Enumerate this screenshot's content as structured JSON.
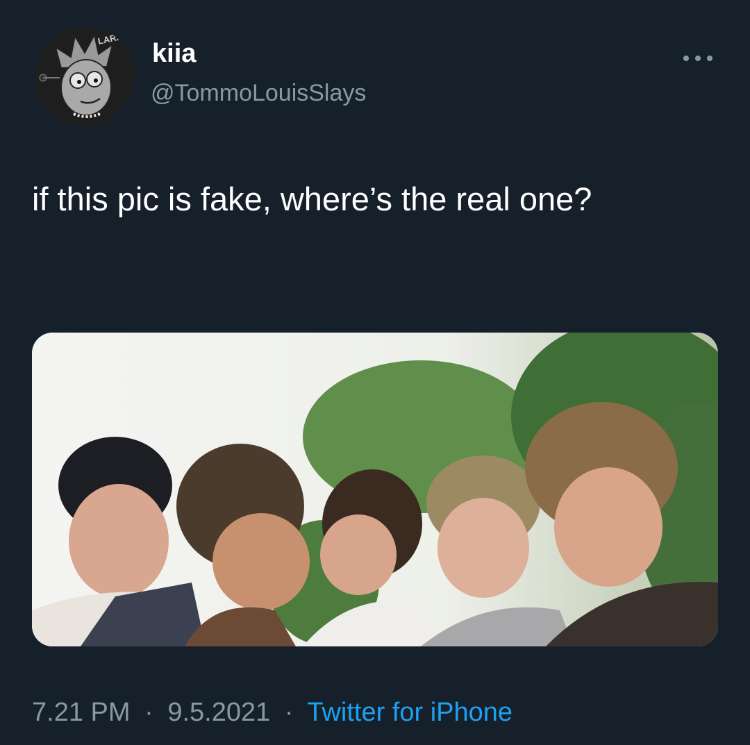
{
  "user": {
    "display_name": "kiia",
    "handle": "@TommoLouisSlays",
    "avatar_badge_text": "LARRY"
  },
  "tweet": {
    "text": "if this pic is fake, where’s the real one?"
  },
  "footer": {
    "time": "7.21 PM",
    "date": "9.5.2021",
    "separator": "·",
    "source": "Twitter for iPhone"
  },
  "icons": {
    "more": "more-horizontal-icon"
  },
  "colors": {
    "background": "#15202b",
    "text_primary": "#ffffff",
    "text_secondary": "#8899a6",
    "link": "#1da1f2"
  }
}
